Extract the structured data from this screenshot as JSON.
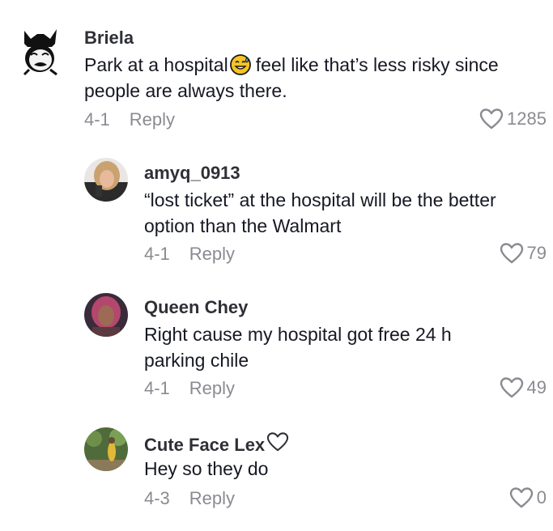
{
  "comments": [
    {
      "username": "Briela",
      "text_before": "Park at a hospital",
      "emoji": "sweat-smile-emoji",
      "text_after": "feel like that’s less risky since people are always there.",
      "date": "4-1",
      "reply_label": "Reply",
      "likes": "1285"
    },
    {
      "username": "amyq_0913",
      "text": "“lost ticket” at the hospital will be the better option than the Walmart",
      "date": "4-1",
      "reply_label": "Reply",
      "likes": "79"
    },
    {
      "username": "Queen Chey",
      "text": "Right cause my hospital got free 24 h parking chile",
      "date": "4-1",
      "reply_label": "Reply",
      "likes": "49"
    },
    {
      "username": "Cute Face Lex",
      "username_suffix_icon": "heart-outline-icon",
      "text": "Hey so they do",
      "date": "4-3",
      "reply_label": "Reply",
      "likes": "0"
    }
  ],
  "colors": {
    "text": "#161823",
    "username": "#2f3036",
    "meta": "#8a8b91"
  }
}
